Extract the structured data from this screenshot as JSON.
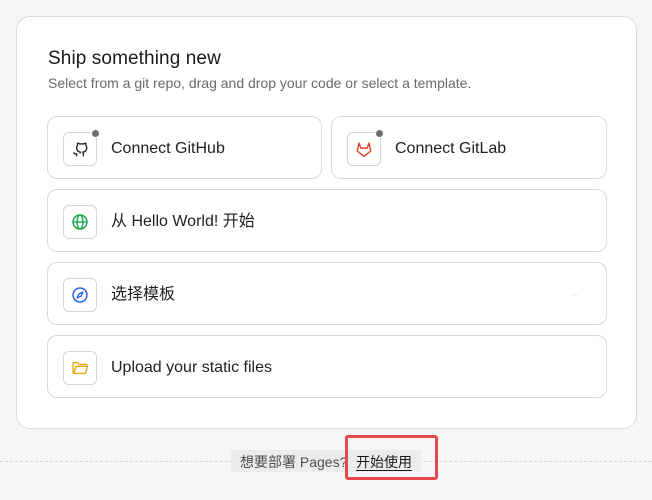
{
  "header": {
    "title": "Ship something new",
    "subtitle": "Select from a git repo, drag and drop your code or select a template."
  },
  "options": [
    {
      "label": "Connect GitHub",
      "icon": "github-icon"
    },
    {
      "label": "Connect GitLab",
      "icon": "gitlab-icon"
    },
    {
      "label": "从 Hello World! 开始",
      "icon": "globe-icon"
    },
    {
      "label": "选择模板",
      "icon": "compass-icon"
    },
    {
      "label": "Upload your static files",
      "icon": "folder-icon"
    }
  ],
  "footer": {
    "text": "想要部署 Pages?",
    "link": "开始使用"
  },
  "colors": {
    "highlight": "#e5484d",
    "gitlab": "#e24329",
    "globe": "#1aa34a",
    "compass": "#2563eb",
    "folder": "#e6a817"
  }
}
